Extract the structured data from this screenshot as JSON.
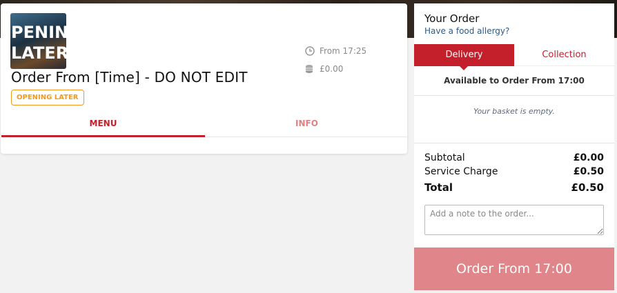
{
  "restaurant": {
    "logo_text_line1": "PENIN",
    "logo_text_line2": "LATER",
    "title": "Order From [Time] - DO NOT EDIT",
    "status_badge": "OPENING LATER",
    "time_label": "From 17:25",
    "fee_label": "£0.00",
    "tabs": [
      {
        "label": "MENU",
        "active": true
      },
      {
        "label": "INFO",
        "active": false
      }
    ]
  },
  "order": {
    "title": "Your Order",
    "allergy_link": "Have a food allergy?",
    "tabs": [
      {
        "label": "Delivery",
        "active": true
      },
      {
        "label": "Collection",
        "active": false
      }
    ],
    "available_text": "Available to Order From 17:00",
    "basket_empty": "Your basket is empty.",
    "subtotal_label": "Subtotal",
    "subtotal_value": "£0.00",
    "service_label": "Service Charge",
    "service_value": "£0.50",
    "total_label": "Total",
    "total_value": "£0.50",
    "note_placeholder": "Add a note to the order...",
    "order_button": "Order From 17:00"
  },
  "colors": {
    "brand_red": "#c4202c",
    "badge_orange": "#f39a1e",
    "button_disabled": "#e08589"
  }
}
